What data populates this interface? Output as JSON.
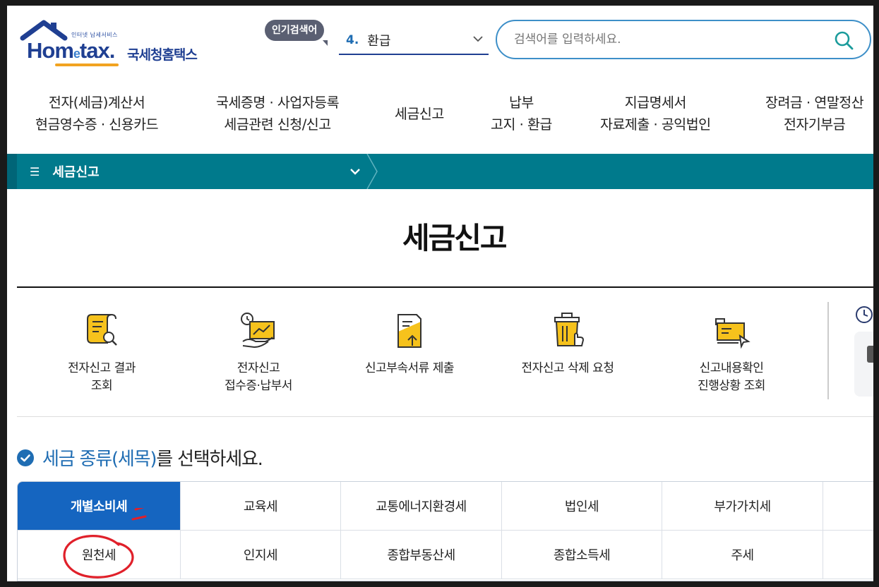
{
  "header": {
    "logo_tagline": "인터넷 납세서비스",
    "logo_brand_pre": "Hom",
    "logo_brand_e": "e",
    "logo_brand_post": "tax.",
    "logo_korean": "국세청홈택스",
    "popular_badge": "인기검색어",
    "popular_rank": "4.",
    "popular_term": "환급",
    "search_placeholder": "검색어를 입력하세요."
  },
  "gnb": [
    {
      "line1": "전자(세금)계산서",
      "line2": "현금영수증 · 신용카드"
    },
    {
      "line1": "국세증명 · 사업자등록",
      "line2": "세금관련 신청/신고"
    },
    {
      "line1": "세금신고",
      "line2": ""
    },
    {
      "line1": "납부",
      "line2": "고지 · 환급"
    },
    {
      "line1": "지급명세서",
      "line2": "자료제출 · 공익법인"
    },
    {
      "line1": "장려금 · 연말정산",
      "line2": "전자기부금"
    }
  ],
  "menu_bar": {
    "label": "세금신고"
  },
  "page_title": "세금신고",
  "quick_menu": [
    {
      "line1": "전자신고 결과",
      "line2": "조회",
      "icon": "report-search-icon"
    },
    {
      "line1": "전자신고",
      "line2": "접수증·납부서",
      "icon": "receipt-chart-icon"
    },
    {
      "line1": "신고부속서류 제출",
      "line2": "",
      "icon": "document-upload-icon"
    },
    {
      "line1": "전자신고 삭제 요청",
      "line2": "",
      "icon": "trash-delete-icon"
    },
    {
      "line1": "신고내용확인",
      "line2": "진행상황 조회",
      "icon": "monitor-check-icon"
    }
  ],
  "section_heading": {
    "highlight": "세금 종류(세목)",
    "rest": "를 선택하세요."
  },
  "tax_tabs": {
    "row1": [
      "개별소비세",
      "교육세",
      "교통에너지환경세",
      "법인세",
      "부가가치세",
      ""
    ],
    "row2": [
      "원천세",
      "인지세",
      "종합부동산세",
      "종합소득세",
      "주세",
      ""
    ],
    "active": "개별소비세"
  },
  "colors": {
    "brand_navy": "#1f3f92",
    "teal_bar": "#007a8c",
    "active_tab": "#1565c0",
    "search_border": "#3d8fc8",
    "annotation_red": "#e0202a"
  }
}
